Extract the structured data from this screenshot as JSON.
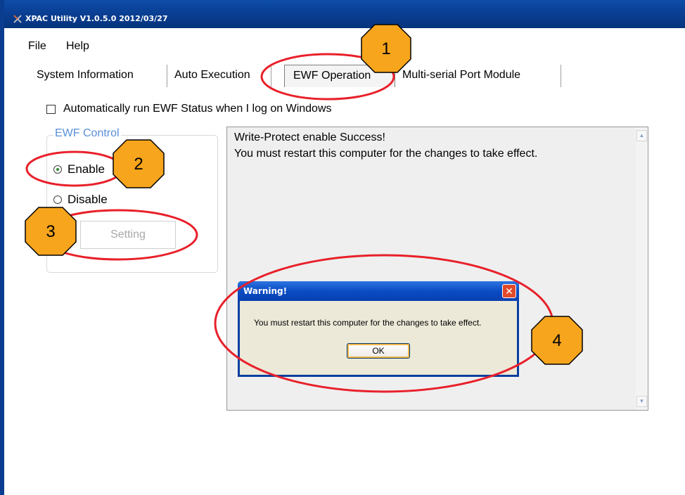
{
  "window": {
    "title": "XPAC Utility V1.0.5.0  2012/03/27",
    "app_icon": "x-logo-icon"
  },
  "menu": [
    "File",
    "Help"
  ],
  "tabs": [
    {
      "label": "System Information",
      "active": false
    },
    {
      "label": "Auto Execution",
      "active": false
    },
    {
      "label": "EWF Operation",
      "active": true
    },
    {
      "label": "Multi-serial Port Module",
      "active": false
    }
  ],
  "auto_run_checkbox": {
    "label": "Automatically run EWF Status when I log on Windows",
    "checked": false
  },
  "ewf_control": {
    "title": "EWF Control",
    "enable_label": "Enable",
    "disable_label": "Disable",
    "selected": "Enable",
    "setting_label": "Setting"
  },
  "output": {
    "lines": [
      "Write-Protect enable Success!",
      "You must restart this computer for the changes to take effect."
    ]
  },
  "dialog": {
    "title": "Warning!",
    "message": "You must restart this computer for the changes to take effect.",
    "ok_label": "OK",
    "close_icon": "close-icon"
  },
  "callouts": [
    "1",
    "2",
    "3",
    "4"
  ],
  "colors": {
    "titlebar": "#0a3f94",
    "callout_fill": "#f7a51c",
    "callout_ring": "#e8202a",
    "group_title": "#5a8fd8"
  }
}
